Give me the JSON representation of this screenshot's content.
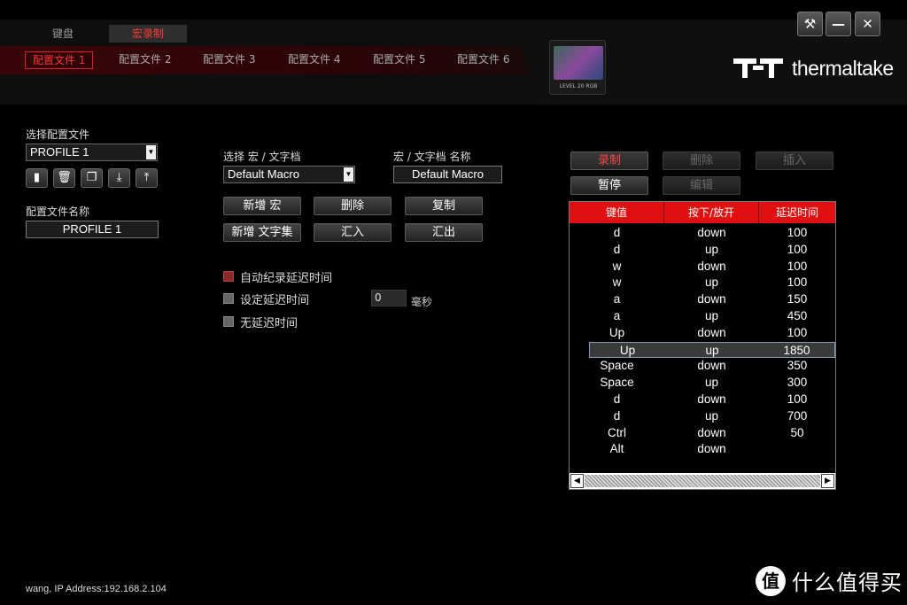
{
  "main_tabs": {
    "keyboard": "键盘",
    "macro": "宏录制"
  },
  "profile_tabs": [
    "配置文件 1",
    "配置文件 2",
    "配置文件 3",
    "配置文件 4",
    "配置文件 5",
    "配置文件 6"
  ],
  "window_controls": {
    "settings": "⚒",
    "minimize": "—",
    "close": "✕"
  },
  "device": {
    "label": "LEVEL 20 RGB"
  },
  "brand": {
    "name": "thermaltake"
  },
  "profile": {
    "select_label": "选择配置文件",
    "selected": "PROFILE 1",
    "name_label": "配置文件名称",
    "name_value": "PROFILE 1"
  },
  "macro": {
    "select_label": "选择 宏 / 文字档",
    "selected": "Default Macro",
    "name_label": "宏 / 文字档 名称",
    "name_value": "Default Macro",
    "buttons": {
      "new_macro": "新增 宏",
      "delete": "删除",
      "copy": "复制",
      "new_text": "新增 文字集",
      "import": "汇入",
      "export": "汇出"
    },
    "options": {
      "auto_delay": "自动纪录延迟时间",
      "set_delay": "设定延迟时间",
      "no_delay": "无延迟时间",
      "delay_value": "0",
      "delay_unit": "毫秒"
    }
  },
  "record_controls": {
    "record": "录制",
    "remove": "删除",
    "insert": "插入",
    "pause": "暂停",
    "edit": "编辑"
  },
  "table": {
    "headers": [
      "键值",
      "按下/放开",
      "延迟时间"
    ],
    "rows": [
      [
        "d",
        "down",
        "100"
      ],
      [
        "d",
        "up",
        "100"
      ],
      [
        "w",
        "down",
        "100"
      ],
      [
        "w",
        "up",
        "100"
      ],
      [
        "a",
        "down",
        "150"
      ],
      [
        "a",
        "up",
        "450"
      ],
      [
        "Up",
        "down",
        "100"
      ],
      [
        "Up",
        "up",
        "1850"
      ],
      [
        "Space",
        "down",
        "350"
      ],
      [
        "Space",
        "up",
        "300"
      ],
      [
        "d",
        "down",
        "100"
      ],
      [
        "d",
        "up",
        "700"
      ],
      [
        "Ctrl",
        "down",
        "50"
      ],
      [
        "Alt",
        "down",
        ""
      ]
    ],
    "selected_row": 7
  },
  "footer": {
    "status": "wang, IP Address:192.168.2.104"
  },
  "watermark": {
    "glyph": "值",
    "text": "什么值得买"
  },
  "colors": {
    "accent": "#e01010",
    "bg": "#000000"
  }
}
